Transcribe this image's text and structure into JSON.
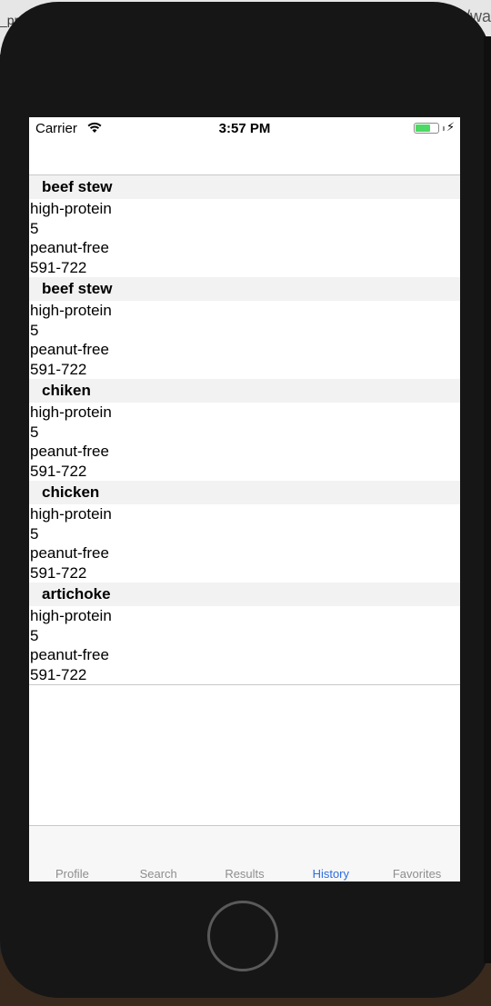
{
  "background": {
    "left_text": "_pr",
    "right_text": "/wa"
  },
  "status_bar": {
    "carrier": "Carrier",
    "time": "3:57 PM",
    "battery_level": 0.65,
    "battery_color": "#4cd964",
    "charging_icon": "bolt-icon",
    "wifi_icon": "wifi-icon"
  },
  "history": [
    {
      "title": "beef stew",
      "lines": [
        "high-protein",
        "5",
        "peanut-free",
        "591-722"
      ]
    },
    {
      "title": "beef stew",
      "lines": [
        "high-protein",
        "5",
        "peanut-free",
        "591-722"
      ]
    },
    {
      "title": "chiken",
      "lines": [
        "high-protein",
        "5",
        "peanut-free",
        "591-722"
      ]
    },
    {
      "title": "chicken",
      "lines": [
        "high-protein",
        "5",
        "peanut-free",
        "591-722"
      ]
    },
    {
      "title": "artichoke",
      "lines": [
        "high-protein",
        "5",
        "peanut-free",
        "591-722"
      ]
    }
  ],
  "tab_bar": {
    "tabs": [
      "Profile",
      "Search",
      "Results",
      "History",
      "Favorites"
    ],
    "active_index": 3,
    "active_color": "#2f6de0"
  }
}
